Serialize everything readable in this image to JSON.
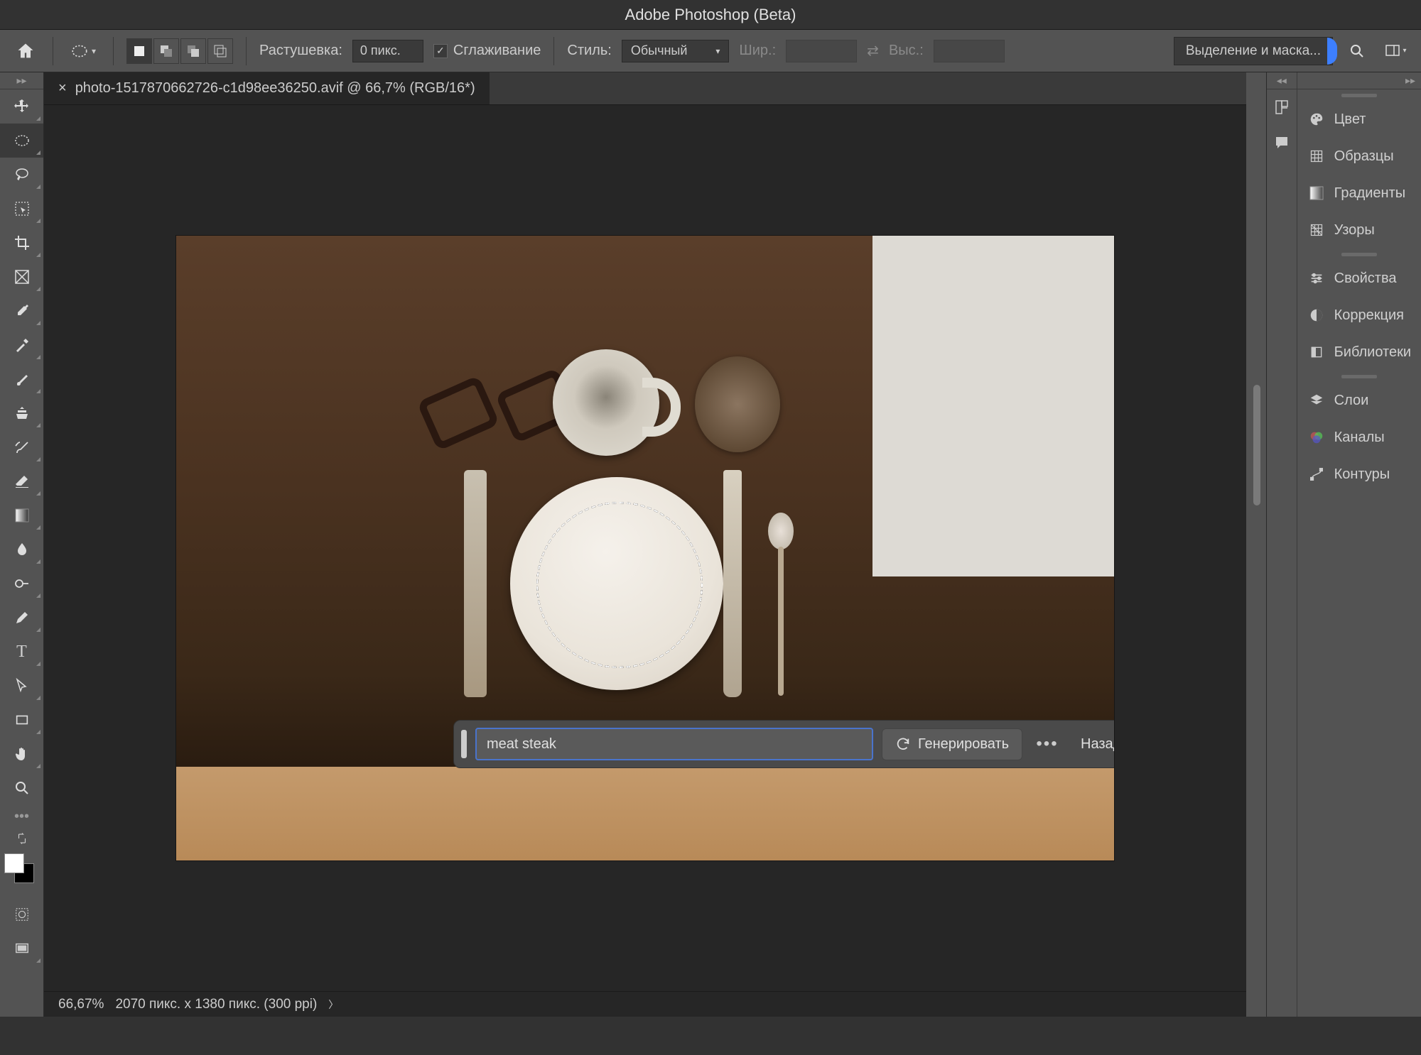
{
  "app_title": "Adobe Photoshop (Beta)",
  "options_bar": {
    "feather_label": "Растушевка:",
    "feather_value": "0 пикс.",
    "antialias_label": "Сглаживание",
    "antialias_checked": true,
    "style_label": "Стиль:",
    "style_value": "Обычный",
    "width_label": "Шир.:",
    "height_label": "Выс.:",
    "select_mask": "Выделение и маска..."
  },
  "document": {
    "tab_title": "photo-1517870662726-c1d98ee36250.avif @ 66,7% (RGB/16*)"
  },
  "generative": {
    "prompt": "meat steak",
    "generate_label": "Генерировать",
    "back_label": "Назад"
  },
  "status": {
    "zoom": "66,67%",
    "dimensions": "2070 пикс. x 1380 пикс. (300 ppi)"
  },
  "right_panels": {
    "color": "Цвет",
    "swatches": "Образцы",
    "gradients": "Градиенты",
    "patterns": "Узоры",
    "properties": "Свойства",
    "adjustments": "Коррекция",
    "libraries": "Библиотеки",
    "layers": "Слои",
    "channels": "Каналы",
    "paths": "Контуры"
  }
}
